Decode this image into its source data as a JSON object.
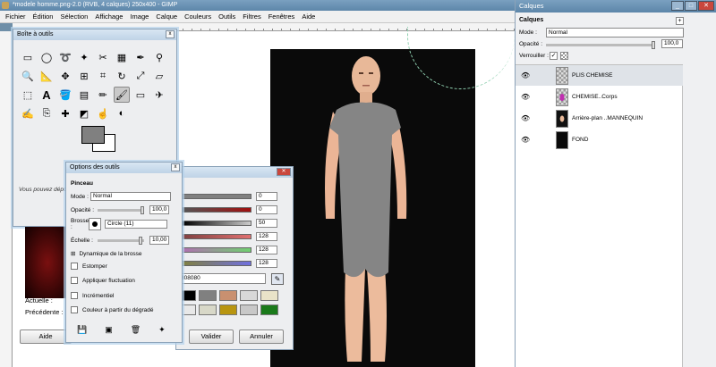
{
  "main_window": {
    "title": "*modele homme.png-2.0 (RVB, 4 calques) 250x400 - GIMP",
    "menu": [
      "Fichier",
      "Édition",
      "Sélection",
      "Affichage",
      "Image",
      "Calque",
      "Couleurs",
      "Outils",
      "Filtres",
      "Fenêtres",
      "Aide"
    ]
  },
  "toolbox": {
    "title": "Boîte à outils",
    "close": "x",
    "hint": "Vous pouvez dépos",
    "tools": [
      "rect-select",
      "ellipse-select",
      "lasso",
      "fuzzy-select",
      "scissors",
      "by-color-select",
      "paths",
      "color-picker",
      "zoom",
      "measure",
      "move",
      "align",
      "crop",
      "rotate",
      "scale",
      "shear",
      "perspective",
      "text",
      "bucket-fill",
      "blend",
      "pencil",
      "paintbrush",
      "eraser",
      "airbrush",
      "ink",
      "clone",
      "heal",
      "perspective-clone",
      "smudge",
      "dodge-burn"
    ],
    "fg_color": "#808080",
    "bg_color": "#ffffff"
  },
  "color_panel": {
    "current_label": "Actuelle :",
    "previous_label": "Précédente :",
    "help_button": "Aide"
  },
  "color_dialog": {
    "rows": [
      {
        "value": "0",
        "color": "#808080"
      },
      {
        "value": "0",
        "color": "#a01010"
      },
      {
        "value": "50",
        "color": "#9a9a9a"
      },
      {
        "value": "128",
        "color": "#e07070"
      },
      {
        "value": "128",
        "color": "#70d070"
      },
      {
        "value": "128",
        "color": "#7070e0"
      }
    ],
    "hex": "808080",
    "swatches_row1": [
      "#000000",
      "#808080",
      "#c99070",
      "#d8d8d8",
      "#e9e3c8"
    ],
    "swatches_row2": [
      "#e8e8e8",
      "#d8d8c8",
      "#b89510",
      "#c8c8c8",
      "#1a7a1a"
    ],
    "validate_button": "Valider",
    "cancel_button": "Annuler"
  },
  "tool_options": {
    "title": "Options des outils",
    "section": "Pinceau",
    "mode_label": "Mode :",
    "mode_value": "Normal",
    "opacity_label": "Opacité :",
    "opacity_value": "100,0",
    "brush_label": "Brosse :",
    "brush_value": "Circle (11)",
    "scale_label": "Échelle :",
    "scale_value": "10,00",
    "brush_dynamics": "Dynamique de la brosse",
    "options": [
      "Estomper",
      "Appliquer fluctuation",
      "Incrémentiel",
      "Couleur à partir du dégradé"
    ]
  },
  "layers_panel": {
    "window_title": "Calques",
    "section": "Calques",
    "mode_label": "Mode :",
    "mode_value": "Normal",
    "opacity_label": "Opacité :",
    "opacity_value": "100,0",
    "lock_label": "Verrouiller :",
    "layers": [
      {
        "name": "PLIS CHEMISE",
        "selected": true,
        "thumb": "checker"
      },
      {
        "name": "CHEMISE..Corps",
        "selected": false,
        "thumb": "checker-shirt"
      },
      {
        "name": "Arrière-plan ..MANNEQUIN",
        "selected": false,
        "thumb": "figure"
      },
      {
        "name": "FOND",
        "selected": false,
        "thumb": "black"
      }
    ]
  }
}
